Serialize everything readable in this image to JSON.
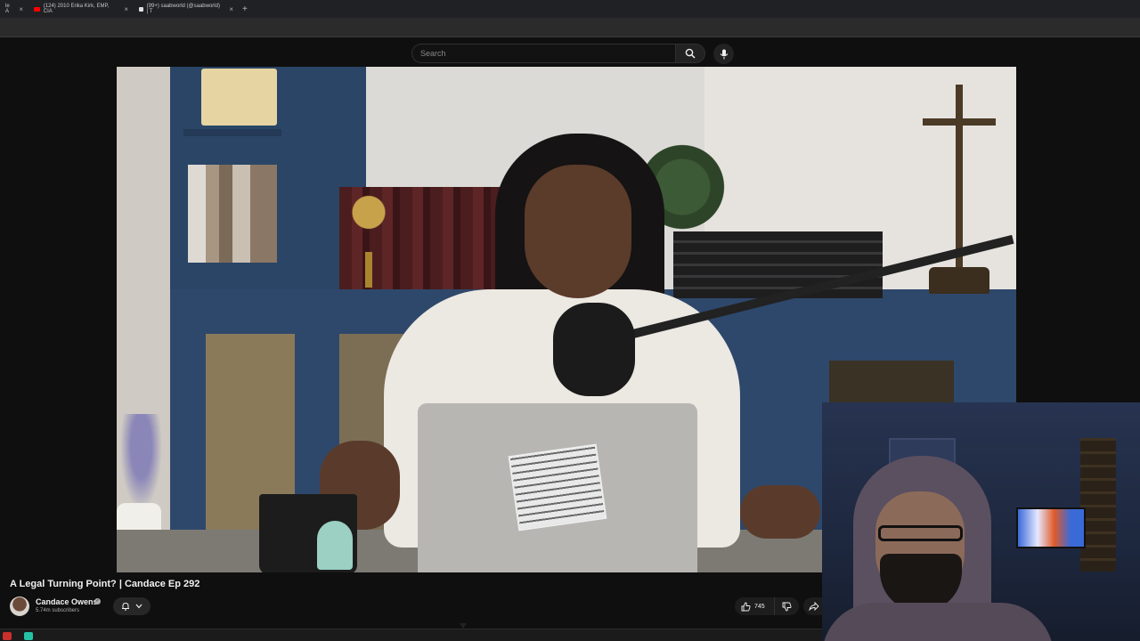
{
  "browser": {
    "tabs": [
      {
        "label": "le A",
        "favicon_color": "#3a3a3a"
      },
      {
        "label": "(124) 2010 Erika Kirk, EMP, CIA",
        "favicon_color": "#ff0000"
      },
      {
        "label": "(99+) saabworld (@saabworld) | T",
        "favicon_color": "#000000"
      }
    ],
    "new_tab_symbol": "+"
  },
  "header": {
    "search_placeholder": "Search",
    "search_icon": "search-icon",
    "mic_icon": "microphone-icon"
  },
  "video": {
    "title": "A Legal Turning Point? | Candace Ep 292",
    "channel": {
      "name": "Candace Owens",
      "verified_mark": "✓",
      "subscribers": "5.74m subscribers"
    },
    "actions": {
      "like_count": "745",
      "like_icon": "thumbs-up-icon",
      "dislike_icon": "thumbs-down-icon",
      "share_icon": "share-icon",
      "notify_icon": "bell-icon"
    }
  },
  "colors": {
    "background": "#0f0f0f",
    "text": "#f1f1f1",
    "muted": "#aaaaaa",
    "taskbar_red": "#c9302c",
    "taskbar_teal": "#24c2a5"
  }
}
